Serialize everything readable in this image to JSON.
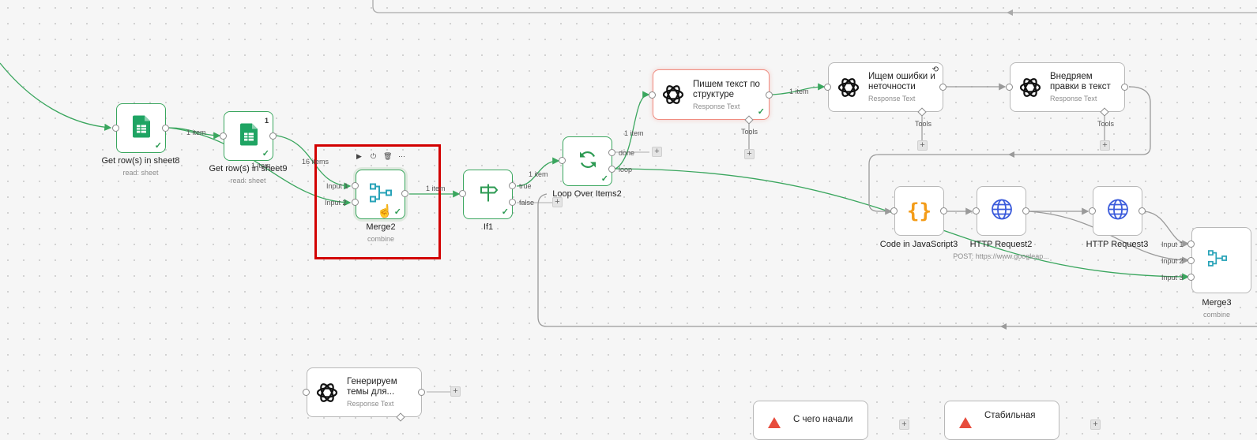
{
  "nodes": {
    "get_rows_8": {
      "title": "Get row(s) in sheet8",
      "subtitle": "read: sheet"
    },
    "get_rows_9": {
      "title": "Get row(s) in sheet9",
      "subtitle": "read: sheet",
      "badge": "1"
    },
    "merge2": {
      "title": "Merge2",
      "subtitle": "combine",
      "input1": "Input 1",
      "input2": "Input 2"
    },
    "if1": {
      "title": "If1",
      "out_true": "true",
      "out_false": "false"
    },
    "loop": {
      "title": "Loop Over Items2",
      "out_done": "done",
      "out_loop": "loop"
    },
    "write_text": {
      "title": "Пишем текст по структуре",
      "subtitle": "Response Text",
      "tools": "Tools"
    },
    "find_errors": {
      "title": "Ищем ошибки и неточности",
      "subtitle": "Response Text",
      "tools": "Tools"
    },
    "apply_edits": {
      "title": "Внедряем правки в текст",
      "subtitle": "Response Text",
      "tools": "Tools"
    },
    "code_js": {
      "title": "Code in JavaScript3"
    },
    "http2": {
      "title": "HTTP Request2",
      "subtitle": "POST: https://www.googleap..."
    },
    "http3": {
      "title": "HTTP Request3"
    },
    "merge3": {
      "title": "Merge3",
      "subtitle": "combine",
      "input1": "Input 1",
      "input2": "Input 2",
      "input3": "Input 3"
    },
    "gen_topics": {
      "title": "Генерируем темы для...",
      "subtitle": "Response Text"
    },
    "start_from": {
      "title": "С чего начали"
    },
    "stable": {
      "title": "Стабильная"
    }
  },
  "edges": {
    "e1": "1 item",
    "e2": "1 item",
    "e3": "16 items",
    "e4": "1 item",
    "e5": "1 item",
    "e6": "1 item",
    "e7": "1 item"
  },
  "node_toolbar": {
    "run": "▶",
    "power": "⏻",
    "delete": "🗑",
    "more": "⋯"
  },
  "icons": {
    "sheets": "google-sheets-icon",
    "openai": "openai-icon",
    "merge": "merge-icon",
    "if": "signpost-icon",
    "loop": "refresh-icon",
    "code": "braces-icon",
    "http": "globe-icon"
  },
  "colors": {
    "success": "#2c9a52",
    "highlight": "#d20000",
    "code": "#f39c19",
    "http": "#3b5bdb",
    "merge": "#29a3b8"
  }
}
